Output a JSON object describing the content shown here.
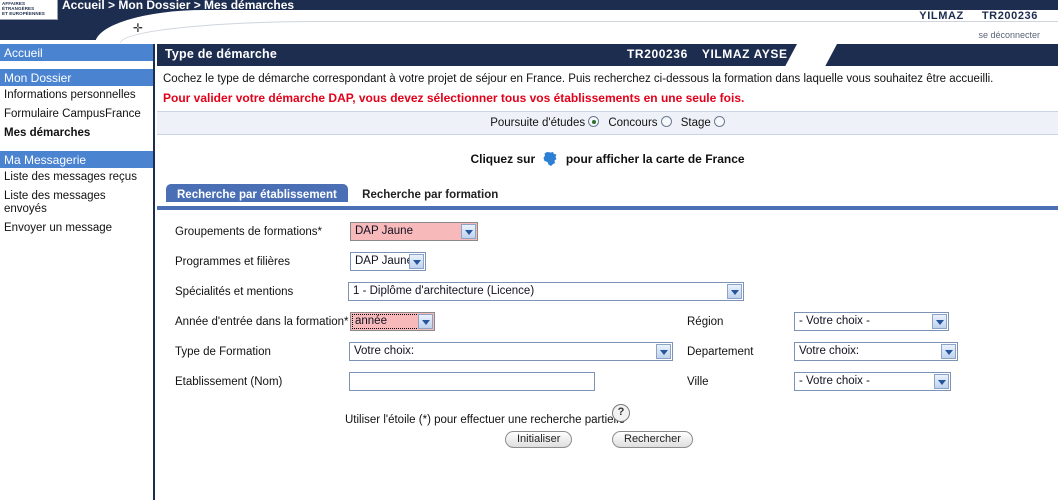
{
  "header": {
    "logo_lines": [
      "AFFAIRES ÉTRANGÈRES",
      "ET EUROPÉENNES"
    ],
    "breadcrumb": "Accueil > Mon Dossier > Mes démarches",
    "user_name": "YILMAZ",
    "user_id": "TR200236",
    "logout_label": "se déconnecter"
  },
  "sidebar": {
    "sections": [
      {
        "title": "Accueil",
        "items": []
      },
      {
        "title": "Mon Dossier",
        "items": [
          {
            "label": "Informations personnelles",
            "current": false
          },
          {
            "label": "Formulaire CampusFrance",
            "current": false
          },
          {
            "label": "Mes démarches",
            "current": true
          }
        ]
      },
      {
        "title": "Ma Messagerie",
        "items": [
          {
            "label": "Liste des messages reçus",
            "current": false
          },
          {
            "label": "Liste des messages envoyés",
            "current": false
          },
          {
            "label": "Envoyer un message",
            "current": false
          }
        ]
      }
    ]
  },
  "page": {
    "title": "Type de démarche",
    "title_user_id": "TR200236",
    "title_user_name": "YILMAZ AYSE",
    "intro": "Cochez le type de démarche correspondant à votre projet de séjour en France. Puis recherchez ci-dessous la formation dans laquelle vous souhaitez être accueilli.",
    "warning": "Pour valider votre démarche DAP, vous devez sélectionner tous vos établissements en une seule fois.",
    "radios": [
      {
        "label": "Poursuite d'études",
        "selected": true
      },
      {
        "label": "Concours",
        "selected": false
      },
      {
        "label": "Stage",
        "selected": false
      }
    ],
    "map_text_before": "Cliquez sur",
    "map_text_after": "pour afficher la carte de France",
    "map_icon": "france-map-icon"
  },
  "tabs": [
    {
      "label": "Recherche par établissement",
      "active": true
    },
    {
      "label": "Recherche par formation",
      "active": false
    }
  ],
  "form": {
    "left": [
      {
        "label": "Groupements de formations*",
        "value": "DAP Jaune",
        "control": "select",
        "state": "required"
      },
      {
        "label": "Programmes et filières",
        "value": "DAP Jaune",
        "control": "select",
        "state": "normal"
      },
      {
        "label": "Spécialités et mentions",
        "value": "1 - Diplôme d'architecture (Licence)",
        "control": "select",
        "state": "normal"
      },
      {
        "label": "Année d'entrée dans la formation*",
        "value": "année",
        "control": "select",
        "state": "required-focus"
      },
      {
        "label": "Type de Formation",
        "value": "Votre choix:",
        "control": "select",
        "state": "normal"
      },
      {
        "label": "Etablissement (Nom)",
        "value": "",
        "control": "text",
        "state": "normal"
      }
    ],
    "right": [
      {
        "label": "Région",
        "value": "- Votre choix -",
        "control": "select"
      },
      {
        "label": "Departement",
        "value": "Votre choix:",
        "control": "select"
      },
      {
        "label": "Ville",
        "value": "- Votre choix -",
        "control": "select"
      }
    ],
    "hint": "Utiliser l'étoile (*) pour effectuer une recherche partielle",
    "help_icon": "question-mark-icon",
    "buttons": [
      {
        "label": "Initialiser"
      },
      {
        "label": "Rechercher"
      }
    ]
  },
  "colors": {
    "navy": "#1d2d50",
    "nav_blue": "#4a83d0",
    "tab_blue": "#4a6fb5",
    "warning_red": "#e2001a",
    "required_pink": "#f7b9b9"
  }
}
